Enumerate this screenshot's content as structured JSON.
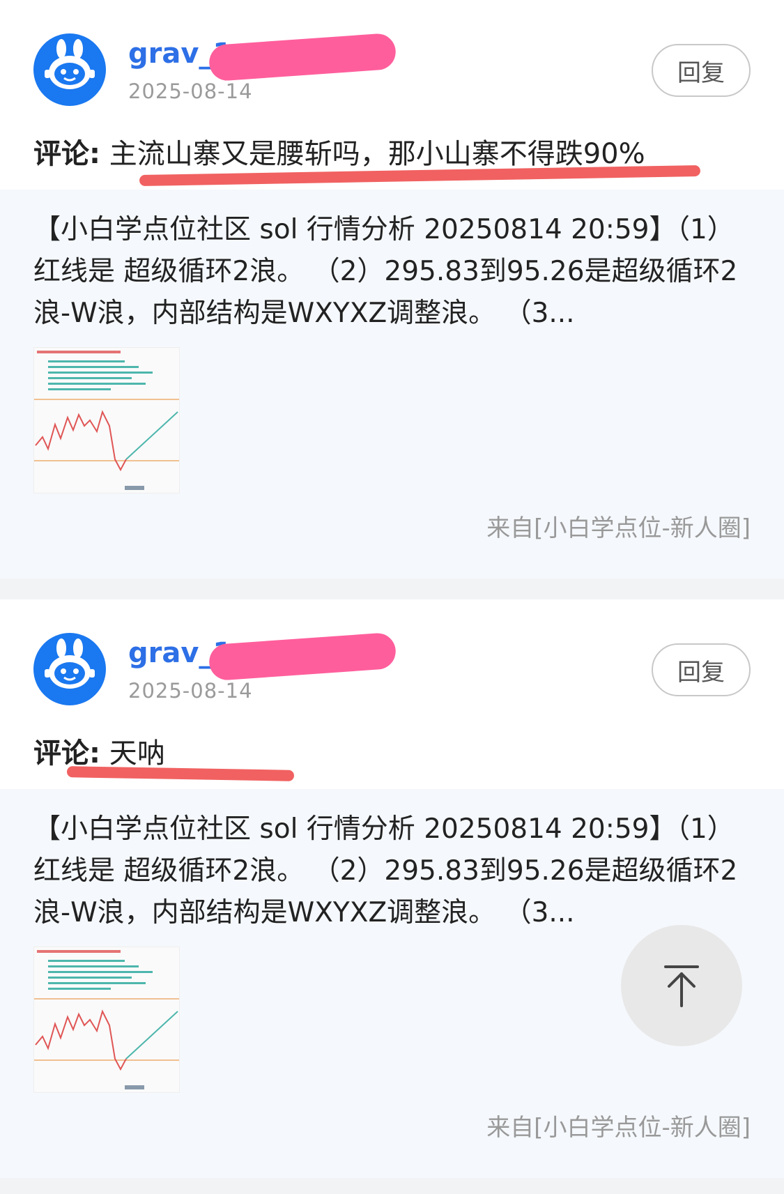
{
  "comments": [
    {
      "username": "grav_1",
      "date": "2025-08-14",
      "reply_label": "回复",
      "comment_label": "评论:",
      "comment_text": "主流山寨又是腰斩吗，那小山寨不得跌90%",
      "quote_text": "【小白学点位社区 sol 行情分析 20250814 20:59】（1） 红线是 超级循环2浪。 （2）295.83到95.26是超级循环2浪-W浪，内部结构是WXYXZ调整浪。 （3...",
      "source": "来自[小白学点位-新人圈]",
      "avatar_icon": "rabbit-robot-icon"
    },
    {
      "username": "grav_1",
      "date": "2025-08-14",
      "reply_label": "回复",
      "comment_label": "评论:",
      "comment_text": "天呐",
      "quote_text": "【小白学点位社区 sol 行情分析 20250814 20:59】（1） 红线是 超级循环2浪。 （2）295.83到95.26是超级循环2浪-W浪，内部结构是WXYXZ调整浪。 （3...",
      "source": "来自[小白学点位-新人圈]",
      "avatar_icon": "rabbit-robot-icon"
    }
  ],
  "scroll_top_icon": "arrow-up-to-top-icon",
  "colors": {
    "username": "#2d6fe6",
    "avatar_bg": "#1a78f0",
    "redaction": "#ff5e9c",
    "underline": "#f05050",
    "quote_bg": "#f5f8fc"
  }
}
